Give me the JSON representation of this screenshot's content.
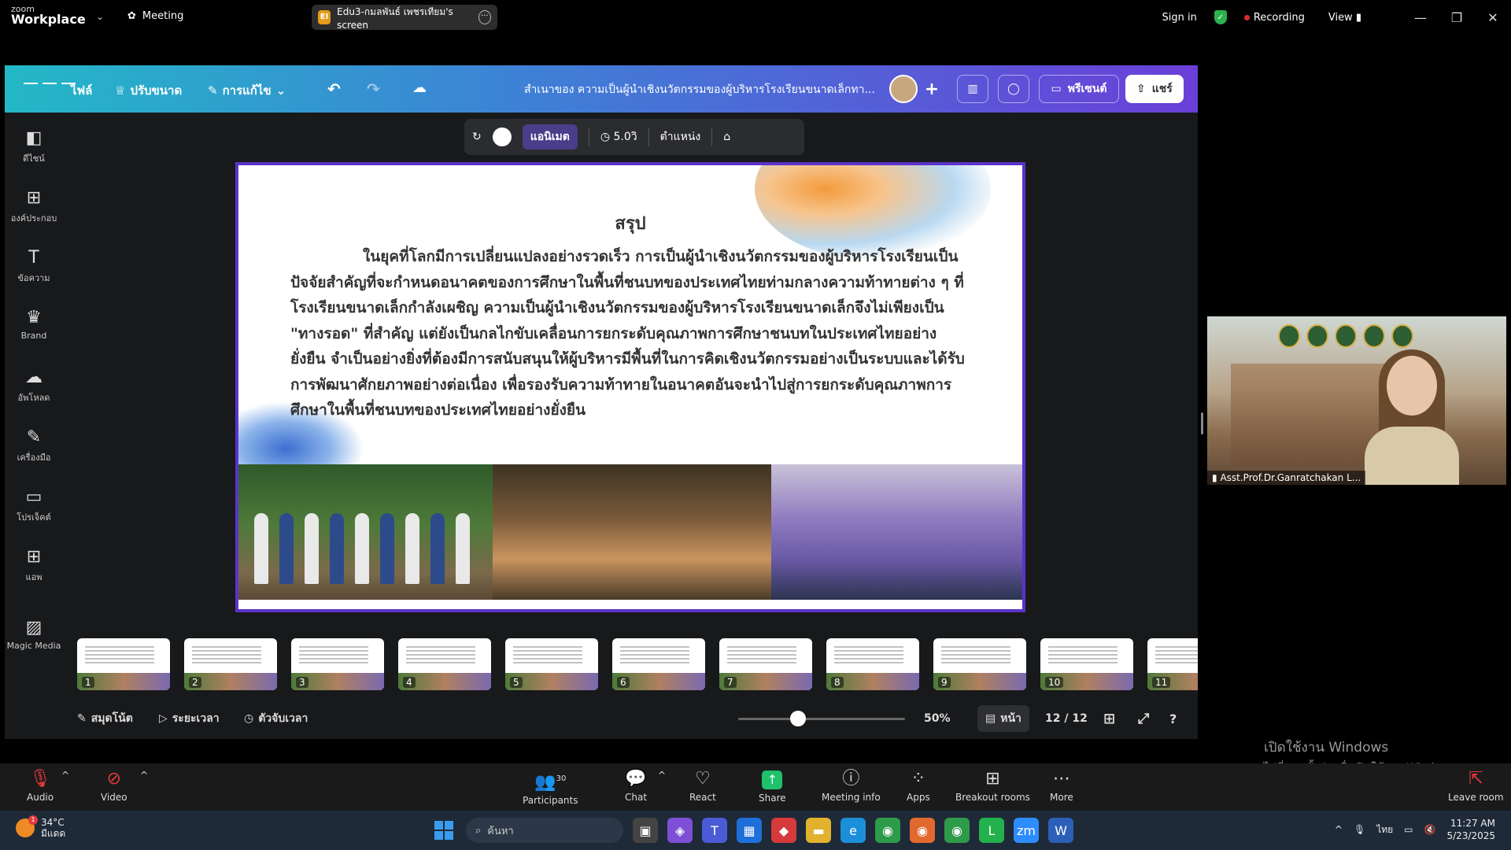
{
  "zoom_top": {
    "logo_small": "zoom",
    "logo_big": "Workplace",
    "meeting": "Meeting",
    "screen_avatar": "EI",
    "screen_label": "Edu3-กมลพันธ์ เพชรเทียม's screen",
    "sign_in": "Sign in",
    "recording": "Recording",
    "view": "View"
  },
  "canva": {
    "menu": {
      "file": "ไฟล์",
      "resize": "ปรับขนาด",
      "edit": "การแก้ไข"
    },
    "doc_title": "สำเนาของ ความเป็นผู้นำเชิงนวัตกรรมของผู้บริหารโรงเรียนขนาดเล็กทา...",
    "present": "พรีเซนต์",
    "share": "แชร์",
    "float_bar": {
      "animate": "แอนิเมต",
      "duration": "5.0วิ",
      "position": "ตำแหน่ง"
    },
    "rail": [
      {
        "label": "ดีไซน์",
        "icon": "design-icon"
      },
      {
        "label": "องค์ประกอบ",
        "icon": "elements-icon"
      },
      {
        "label": "ข้อความ",
        "icon": "text-icon"
      },
      {
        "label": "Brand",
        "icon": "brand-icon"
      },
      {
        "label": "อัพโหลด",
        "icon": "upload-icon"
      },
      {
        "label": "เครื่องมือ",
        "icon": "tools-icon"
      },
      {
        "label": "โปรเจ็คต์",
        "icon": "projects-icon"
      },
      {
        "label": "แอพ",
        "icon": "apps-icon"
      },
      {
        "label": "Magic Media",
        "icon": "magic-media-icon"
      }
    ],
    "slide": {
      "title": "สรุป",
      "body": "ในยุคที่โลกมีการเปลี่ยนแปลงอย่างรวดเร็ว การเป็นผู้นำเชิงนวัตกรรมของผู้บริหารโรงเรียนเป็นปัจจัยสำคัญที่จะกำหนดอนาคตของการศึกษาในพื้นที่ชนบทของประเทศไทยท่ามกลางความท้าทายต่าง ๆ ที่โรงเรียนขนาดเล็กกำลังเผชิญ ความเป็นผู้นำเชิงนวัตกรรมของผู้บริหารโรงเรียนขนาดเล็กจึงไม่เพียงเป็น \"ทางรอด\" ที่สำคัญ แต่ยังเป็นกลไกขับเคลื่อนการยกระดับคุณภาพการศึกษาชนบทในประเทศไทยอย่างยั่งยืน จำเป็นอย่างยิ่งที่ต้องมีการสนับสนุนให้ผู้บริหารมีพื้นที่ในการคิดเชิงนวัตกรรมอย่างเป็นระบบและได้รับการพัฒนาศักยภาพอย่างต่อเนื่อง เพื่อรองรับความท้าทายในอนาคตอันจะนำไปสู่การยกระดับคุณภาพการศึกษาในพื้นที่ชนบทของประเทศไทยอย่างยั่งยืน"
    },
    "thumbnails": [
      "1",
      "2",
      "3",
      "4",
      "5",
      "6",
      "7",
      "8",
      "9",
      "10",
      "11"
    ],
    "bottom": {
      "notes": "สมุดโน้ต",
      "timeline": "ระยะเวลา",
      "timer": "ตัวจับเวลา",
      "zoom_percent": 50,
      "zoom": "50%",
      "page_view": "หน้า",
      "page_count": "12 / 12"
    }
  },
  "video_tile": {
    "name": "Asst.Prof.Dr.Ganratchakan L..."
  },
  "windows_activation": {
    "title": "เปิดใช้งาน Windows",
    "sub": "ไปที่ การตั้งค่า เพื่อเปิดใช้งาน Windows"
  },
  "zoom_controls": {
    "audio": "Audio",
    "video": "Video",
    "participants": "Participants",
    "participants_count": "30",
    "chat": "Chat",
    "react": "React",
    "share": "Share",
    "meeting_info": "Meeting info",
    "apps": "Apps",
    "breakout": "Breakout rooms",
    "more": "More",
    "leave": "Leave room"
  },
  "taskbar": {
    "temp": "34°C",
    "weather": "มีแดด",
    "weather_badge": "1",
    "search": "ค้นหา",
    "lang": "ไทย",
    "time": "11:27 AM",
    "date": "5/23/2025"
  }
}
